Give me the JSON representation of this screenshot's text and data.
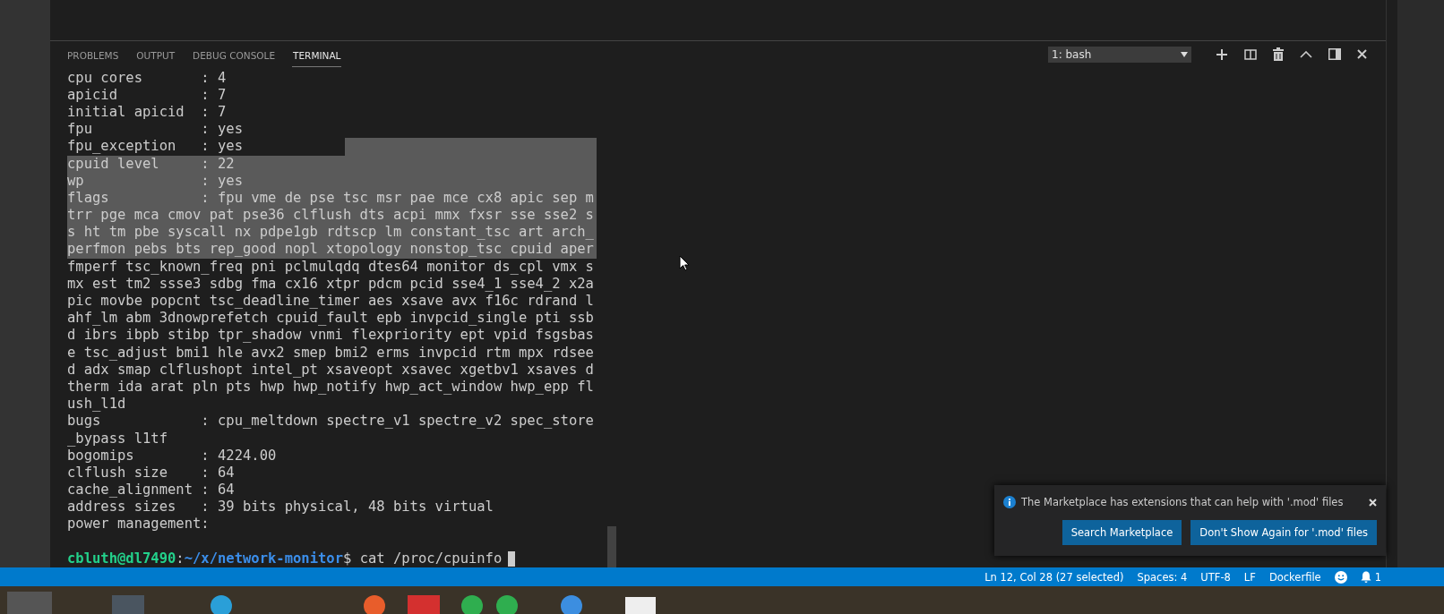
{
  "panel": {
    "tabs": [
      {
        "label": "PROBLEMS",
        "selected": false
      },
      {
        "label": "OUTPUT",
        "selected": false
      },
      {
        "label": "DEBUG CONSOLE",
        "selected": false
      },
      {
        "label": "TERMINAL",
        "selected": true
      }
    ],
    "terminal_select": {
      "value": "1: bash"
    }
  },
  "terminal": {
    "lines": [
      {
        "text": "cpu cores       : 4",
        "selected": false
      },
      {
        "text": "apicid          : 7",
        "selected": false
      },
      {
        "text": "initial apicid  : 7",
        "selected": false
      },
      {
        "text": "fpu             : yes",
        "selected": false
      },
      {
        "text": "fpu_exception   : yes",
        "selected": false,
        "trailing_selection": true
      },
      {
        "text": "cpuid level     : 22",
        "selected": true
      },
      {
        "text": "wp              : yes",
        "selected": true
      },
      {
        "text": "flags           : fpu vme de pse tsc msr pae mce cx8 apic sep m",
        "selected": true
      },
      {
        "text": "trr pge mca cmov pat pse36 clflush dts acpi mmx fxsr sse sse2 s",
        "selected": true
      },
      {
        "text": "s ht tm pbe syscall nx pdpe1gb rdtscp lm constant_tsc art arch_",
        "selected": true
      },
      {
        "text": "perfmon pebs bts rep_good nopl xtopology nonstop_tsc cpuid aper",
        "selected": true
      },
      {
        "text": "fmperf tsc_known_freq pni pclmulqdq dtes64 monitor ds_cpl vmx s",
        "selected": false
      },
      {
        "text": "mx est tm2 ssse3 sdbg fma cx16 xtpr pdcm pcid sse4_1 sse4_2 x2a",
        "selected": false
      },
      {
        "text": "pic movbe popcnt tsc_deadline_timer aes xsave avx f16c rdrand l",
        "selected": false
      },
      {
        "text": "ahf_lm abm 3dnowprefetch cpuid_fault epb invpcid_single pti ssb",
        "selected": false
      },
      {
        "text": "d ibrs ibpb stibp tpr_shadow vnmi flexpriority ept vpid fsgsbas",
        "selected": false
      },
      {
        "text": "e tsc_adjust bmi1 hle avx2 smep bmi2 erms invpcid rtm mpx rdsee",
        "selected": false
      },
      {
        "text": "d adx smap clflushopt intel_pt xsaveopt xsavec xgetbv1 xsaves d",
        "selected": false
      },
      {
        "text": "therm ida arat pln pts hwp hwp_notify hwp_act_window hwp_epp fl",
        "selected": false
      },
      {
        "text": "ush_l1d",
        "selected": false
      },
      {
        "text": "bugs            : cpu_meltdown spectre_v1 spectre_v2 spec_store",
        "selected": false
      },
      {
        "text": "_bypass l1tf",
        "selected": false
      },
      {
        "text": "bogomips        : 4224.00",
        "selected": false
      },
      {
        "text": "clflush size    : 64",
        "selected": false
      },
      {
        "text": "cache_alignment : 64",
        "selected": false
      },
      {
        "text": "address sizes   : 39 bits physical, 48 bits virtual",
        "selected": false
      },
      {
        "text": "power management:",
        "selected": false
      }
    ],
    "prompt": {
      "user_host": "cbluth@dl7490",
      "separator": ":",
      "path": "~/x/network-monitor",
      "command": "$ cat /proc/cpuinfo"
    }
  },
  "notification": {
    "message": "The Marketplace has extensions that can help with '.mod' files",
    "buttons": [
      "Search Marketplace",
      "Don't Show Again for '.mod' files"
    ]
  },
  "status_bar": {
    "items": [
      "Ln 12, Col 28 (27 selected)",
      "Spaces: 4",
      "UTF-8",
      "LF",
      "Dockerfile"
    ],
    "notifications_count": "1"
  }
}
